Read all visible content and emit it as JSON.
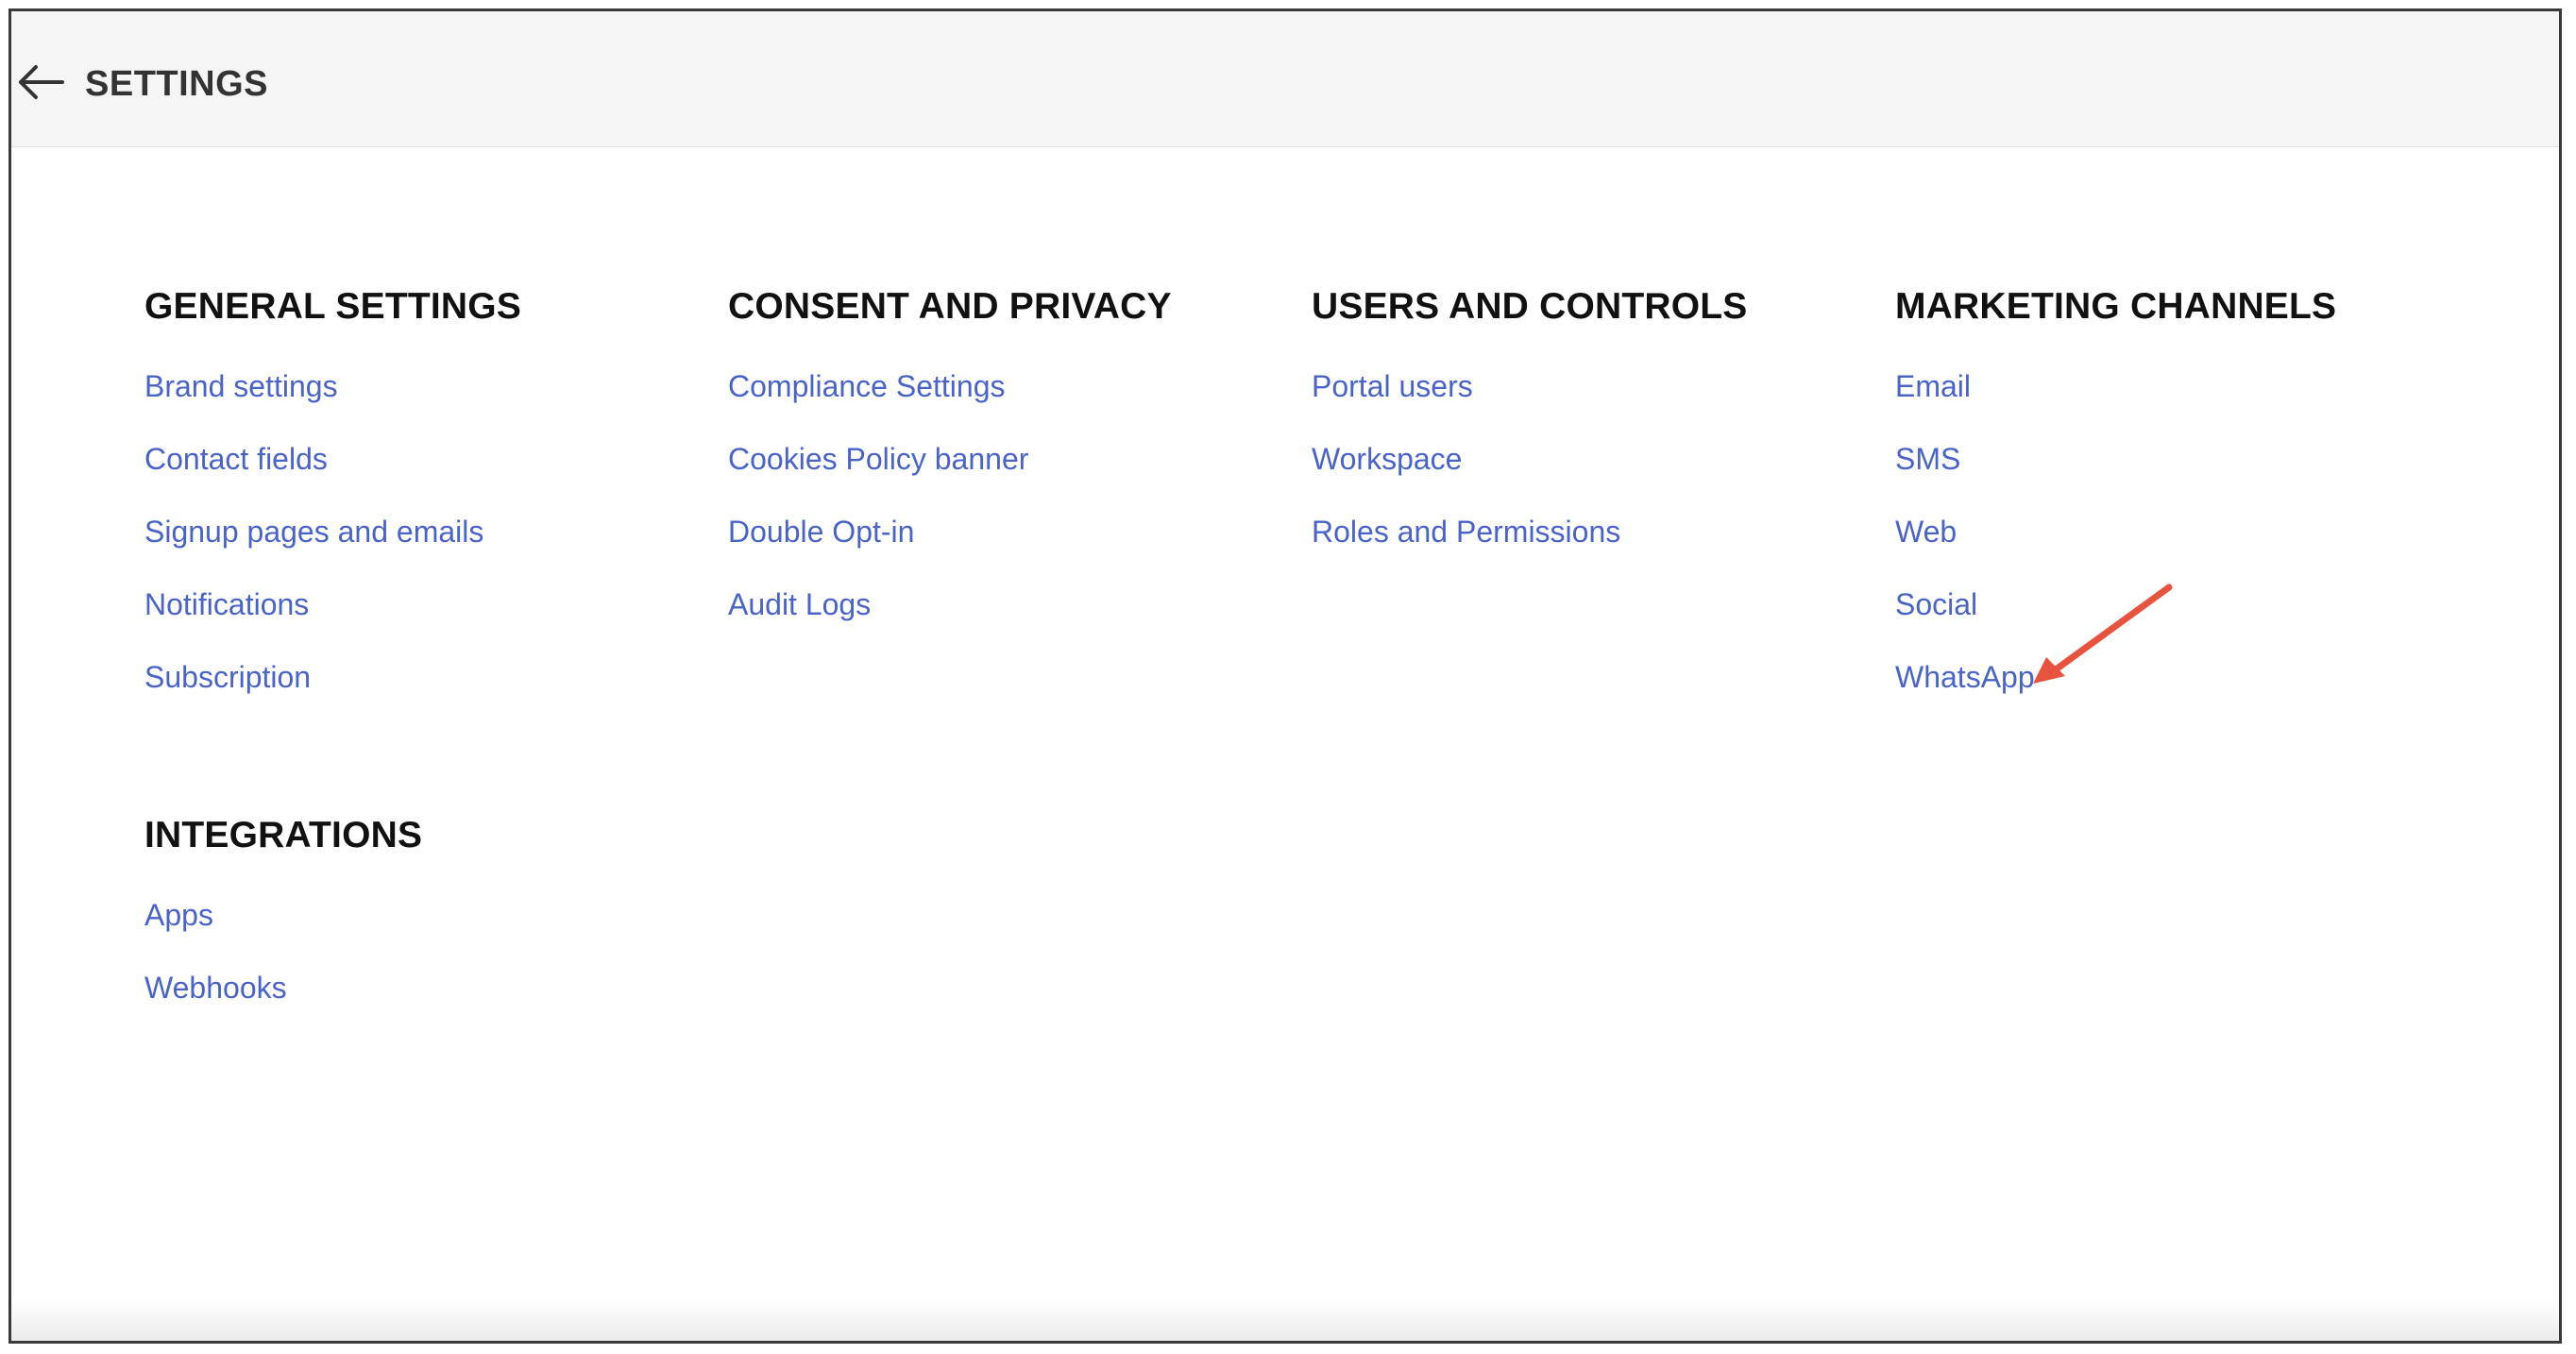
{
  "header": {
    "title": "SETTINGS",
    "back_icon": "arrow-left-icon"
  },
  "sections": {
    "general": {
      "title": "GENERAL SETTINGS",
      "items": [
        {
          "label": "Brand settings"
        },
        {
          "label": "Contact fields"
        },
        {
          "label": "Signup pages and emails"
        },
        {
          "label": "Notifications"
        },
        {
          "label": "Subscription"
        }
      ]
    },
    "consent": {
      "title": "CONSENT AND PRIVACY",
      "items": [
        {
          "label": "Compliance Settings"
        },
        {
          "label": "Cookies Policy banner"
        },
        {
          "label": "Double Opt-in"
        },
        {
          "label": "Audit Logs"
        }
      ]
    },
    "users": {
      "title": "USERS AND CONTROLS",
      "items": [
        {
          "label": "Portal users"
        },
        {
          "label": "Workspace"
        },
        {
          "label": "Roles and Permissions"
        }
      ]
    },
    "marketing": {
      "title": "MARKETING CHANNELS",
      "items": [
        {
          "label": "Email"
        },
        {
          "label": "SMS"
        },
        {
          "label": "Web"
        },
        {
          "label": "Social"
        },
        {
          "label": "WhatsApp"
        }
      ]
    },
    "integrations": {
      "title": "INTEGRATIONS",
      "items": [
        {
          "label": "Apps"
        },
        {
          "label": "Webhooks"
        }
      ]
    }
  },
  "annotation": {
    "icon": "annotation-arrow-icon",
    "color": "#e8533f"
  },
  "colors": {
    "link": "#4a63c9",
    "heading": "#111111",
    "header_bg": "#f5f5f5"
  }
}
